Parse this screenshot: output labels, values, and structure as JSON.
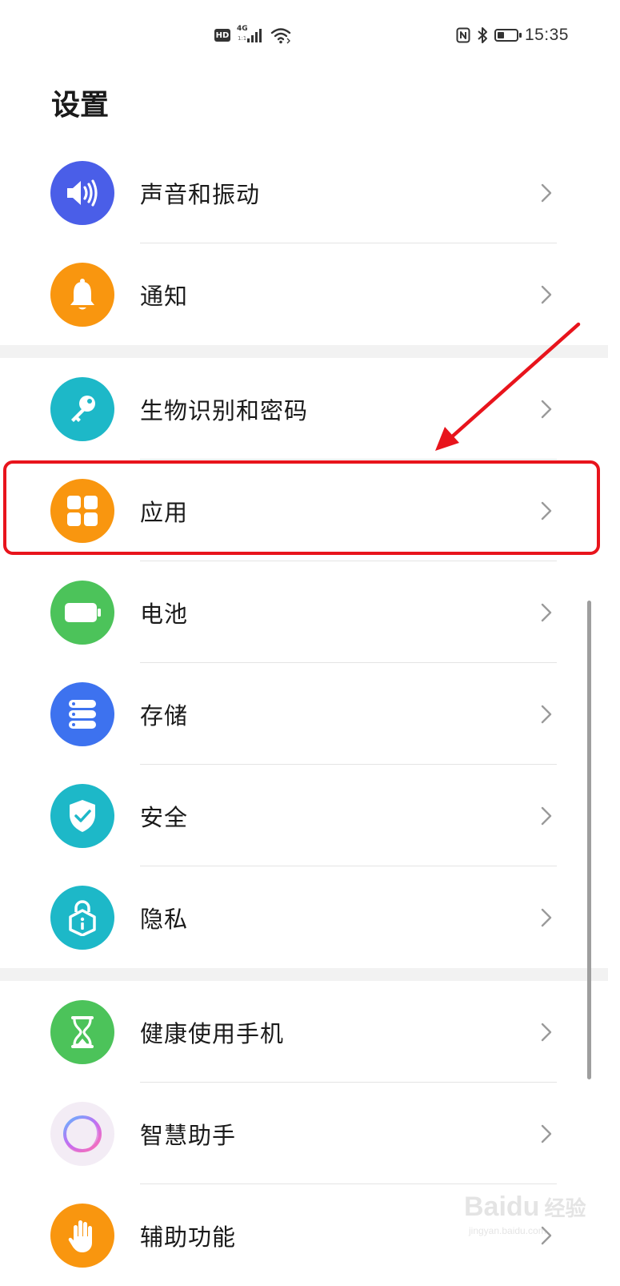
{
  "status_bar": {
    "hd": "HD",
    "network": "4G",
    "network_sub": "1:1",
    "time": "15:35",
    "battery_level": 0.35,
    "icons": [
      "hd-icon",
      "signal-icon",
      "wifi-icon",
      "nfc-icon",
      "bluetooth-icon",
      "battery-icon"
    ]
  },
  "page": {
    "title": "设置"
  },
  "settings": [
    {
      "group": 1,
      "label": "声音和振动",
      "icon": "speaker-icon",
      "color": "#4a5ee8"
    },
    {
      "group": 1,
      "label": "通知",
      "icon": "bell-icon",
      "color": "#f9960f"
    },
    {
      "group": 2,
      "label": "生物识别和密码",
      "icon": "key-icon",
      "color": "#1db8c8"
    },
    {
      "group": 2,
      "label": "应用",
      "icon": "apps-grid-icon",
      "color": "#f9960f",
      "highlighted": true
    },
    {
      "group": 2,
      "label": "电池",
      "icon": "battery-icon",
      "color": "#4cc35a"
    },
    {
      "group": 2,
      "label": "存储",
      "icon": "storage-icon",
      "color": "#3d72ef"
    },
    {
      "group": 2,
      "label": "安全",
      "icon": "shield-icon",
      "color": "#1db8c8"
    },
    {
      "group": 2,
      "label": "隐私",
      "icon": "privacy-lock-icon",
      "color": "#1db8c8"
    },
    {
      "group": 3,
      "label": "健康使用手机",
      "icon": "hourglass-icon",
      "color": "#4cc35a"
    },
    {
      "group": 3,
      "label": "智慧助手",
      "icon": "assistant-ring-icon",
      "color": "#f3ecf5"
    },
    {
      "group": 3,
      "label": "辅助功能",
      "icon": "hand-icon",
      "color": "#f9960f"
    }
  ],
  "annotation": {
    "color": "#e8141c"
  },
  "watermark": {
    "brand": "Baidu",
    "suffix": "经验",
    "url": "jingyan.baidu.com"
  }
}
